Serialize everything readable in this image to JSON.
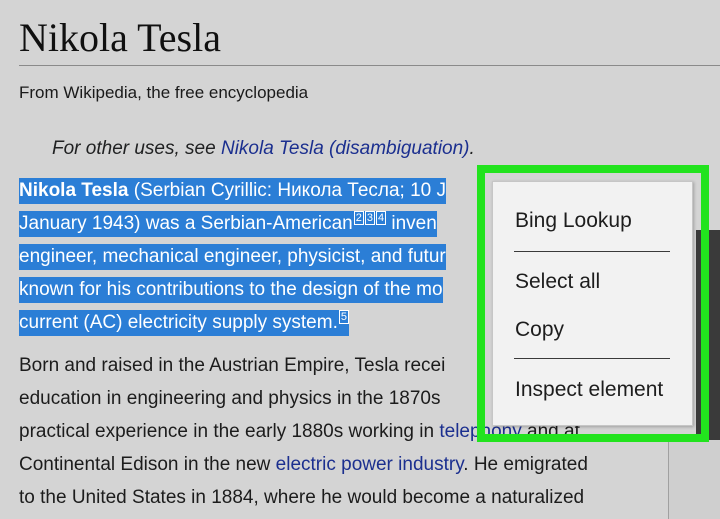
{
  "article": {
    "title": "Nikola Tesla",
    "tagline": "From Wikipedia, the free encyclopedia",
    "hatnote": {
      "prefix": "For other uses, see ",
      "link": "Nikola Tesla (disambiguation)",
      "suffix": "."
    },
    "intro_lines": [
      {
        "bold": "Nikola Tesla",
        "text": " (Serbian Cyrillic: Никола Тесла; 10 J"
      },
      {
        "text": "January 1943) was a Serbian-American",
        "refs": [
          "2",
          "3",
          "4"
        ],
        "after": " inven"
      },
      {
        "text": "engineer, mechanical engineer, physicist, and futur"
      },
      {
        "text": "known for his contributions to the design of the mo"
      },
      {
        "text": "current (AC) electricity supply system.",
        "refs": [
          "5"
        ]
      }
    ],
    "body_lines": [
      {
        "text": "Born and raised in the Austrian Empire, Tesla recei"
      },
      {
        "text": "education in engineering and physics in the 1870s"
      },
      {
        "text": "practical experience in the early 1880s working in ",
        "link": "telephony",
        "after": " and at"
      },
      {
        "text": "Continental Edison in the new ",
        "link": "electric power industry",
        "after": ". He emigrated"
      },
      {
        "text": "to the United States in 1884, where he would become a naturalized"
      }
    ]
  },
  "context_menu": {
    "items": [
      "Bing Lookup",
      "Select all",
      "Copy",
      "Inspect element"
    ]
  },
  "colors": {
    "selection": "#2b7ed6",
    "highlight": "#22e31e",
    "link": "#1b2f8f"
  }
}
